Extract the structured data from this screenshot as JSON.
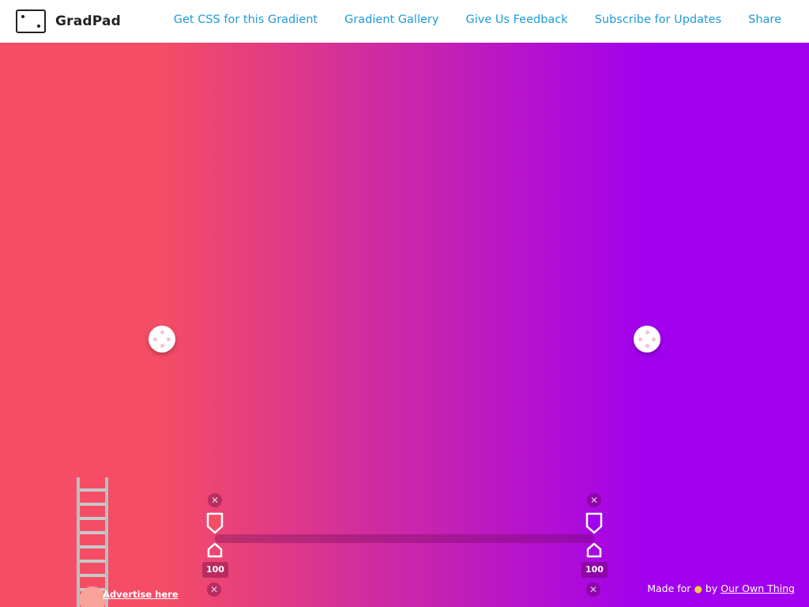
{
  "app": {
    "logo_text": "GradPad"
  },
  "nav": {
    "items": [
      {
        "label": "Get CSS for this Gradient"
      },
      {
        "label": "Gradient Gallery"
      },
      {
        "label": "Give Us Feedback"
      },
      {
        "label": "Subscribe for Updates"
      },
      {
        "label": "Share"
      }
    ]
  },
  "gradient": {
    "direction": "to right",
    "stops": [
      {
        "color": "#f44d65",
        "opacity": "100"
      },
      {
        "color": "#a100ee",
        "opacity": "100"
      }
    ]
  },
  "icons": {
    "logo": "gradpad-logo-icon",
    "handle": "move-handle-icon",
    "remove": "close-x-icon",
    "stop_marker": "color-stop-marker-icon",
    "opacity_marker": "opacity-marker-icon",
    "ladder": "ladder-icon",
    "medal": "medal-icon"
  },
  "ad": {
    "label": "Advertise here"
  },
  "footer": {
    "made_for": "Made for",
    "by": "by",
    "link": "Our Own Thing"
  },
  "colors": {
    "nav_link": "#1e9ad8",
    "start": "#f44d65",
    "end": "#a100ee"
  }
}
